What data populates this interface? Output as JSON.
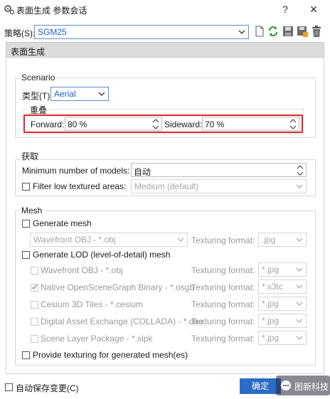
{
  "window": {
    "title": "表面生成 参数会话",
    "help_glyph": "?",
    "close_glyph": "✕"
  },
  "strategy": {
    "label": "策略(S):",
    "value": "SGM25"
  },
  "section_band": "表面生成",
  "scenario": {
    "group_label": "Scenario",
    "type_label": "类型(T):",
    "type_value": "Aerial",
    "overlap_label": "重叠",
    "forward_label": "Forward:",
    "forward_value": "80 %",
    "sideward_label": "Sideward:",
    "sideward_value": "70 %"
  },
  "acquire": {
    "group_label": "获取",
    "min_models_label": "Minimum number of models:",
    "min_models_value": "自动",
    "filter_label": "Filter low textured areas:",
    "filter_value": "Medium (default)"
  },
  "mesh": {
    "group_label": "Mesh",
    "generate_mesh_label": "Generate mesh",
    "mesh_format": "Wavefront OBJ - *.obj",
    "texturing_label": "Texturing format:",
    "texturing_value": ".jpg",
    "generate_lod_label": "Generate LOD (level-of-detail) mesh",
    "lod_rows": [
      {
        "label": "Wavefront OBJ - *.obj",
        "checked": false,
        "texturing": "*.jpg"
      },
      {
        "label": "Native OpenSceneGraph Binary - *.osgb",
        "checked": true,
        "texturing": "*.s3tc"
      },
      {
        "label": "Cesium 3D Tiles - *.cesium",
        "checked": false,
        "texturing": "*.jpg"
      },
      {
        "label": "Digital Asset Exchange (COLLADA) - *.dae",
        "checked": false,
        "texturing": "*.jpg"
      },
      {
        "label": "Scene Layer Package - *.slpk",
        "checked": false,
        "texturing": "*.jpg"
      }
    ],
    "provide_texturing_label": "Provide texturing for generated mesh(es)"
  },
  "footer": {
    "autosave_label": "自动保存变更(C)",
    "ok_label": "确定",
    "watermark_text": "图新科技"
  },
  "colors": {
    "highlight_box": "#e0262b",
    "ok_button": "#2b6cc4",
    "strategy_text": "#1f5fbf"
  }
}
